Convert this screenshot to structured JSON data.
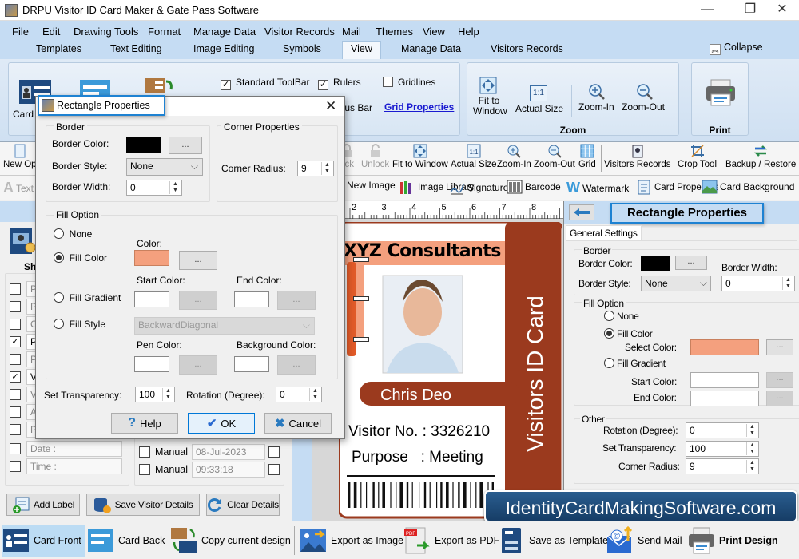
{
  "window": {
    "title": "DRPU Visitor ID Card Maker & Gate Pass Software",
    "controls": {
      "minimize": "—",
      "maximize": "❐",
      "close": "✕"
    }
  },
  "menu": [
    "File",
    "Edit",
    "Drawing Tools",
    "Format",
    "Manage Data",
    "Visitor Records",
    "Mail",
    "Themes",
    "View",
    "Help"
  ],
  "ribbon_tabs": [
    "Templates",
    "Text Editing",
    "Image Editing",
    "Symbols",
    "View",
    "Manage Data",
    "Visitors Records"
  ],
  "active_ribbon_tab": "View",
  "collapse_label": "Collapse",
  "ribbon": {
    "card_front_label": "Card",
    "view_options": [
      {
        "label": "Standard ToolBar",
        "checked": true
      },
      {
        "label": "Rulers",
        "checked": true
      },
      {
        "label": "Gridlines",
        "checked": false
      }
    ],
    "status_bar_label": "tus Bar",
    "grid_properties_link": "Grid Properties",
    "zoom_group": {
      "label": "Zoom",
      "buttons": [
        "Fit to Window",
        "Actual Size",
        "Zoom-In",
        "Zoom-Out"
      ]
    },
    "print_group": {
      "label": "Print"
    }
  },
  "toolbar": {
    "left_partial": "New Op",
    "items": [
      "ock",
      "Unlock",
      "Fit to Window",
      "Actual Size",
      "Zoom-In",
      "Zoom-Out",
      "Grid",
      "Visitors Records",
      "Crop Tool",
      "Backup / Restore"
    ]
  },
  "toolbar2": {
    "left_partial": "Text",
    "items": [
      "New Image",
      "Image Library",
      "Signature",
      "Barcode",
      "Watermark",
      "Card Properties",
      "Card Background"
    ]
  },
  "left_panel": {
    "show_label": "Sh",
    "rows": [
      {
        "label": "P",
        "checked": false
      },
      {
        "label": "P",
        "checked": false
      },
      {
        "label": "C",
        "checked": false
      },
      {
        "label": "Pr",
        "checked": true
      },
      {
        "label": "Pl",
        "checked": false
      },
      {
        "label": "V",
        "checked": true
      },
      {
        "label": "V",
        "checked": false
      },
      {
        "label": "A",
        "checked": false
      },
      {
        "label": "P",
        "checked": false
      },
      {
        "label": "Date :",
        "checked": false
      },
      {
        "label": "Time :",
        "checked": false
      }
    ],
    "manual_rows": [
      {
        "label": "Manual",
        "value": "08-Jul-2023"
      },
      {
        "label": "Manual",
        "value": "09:33:18"
      }
    ],
    "buttons": {
      "add_label": "Add Label",
      "save_visitor": "Save Visitor Details",
      "clear": "Clear Details"
    }
  },
  "dialog": {
    "title": "Rectangle Properties",
    "border": {
      "legend": "Border",
      "color_label": "Border Color:",
      "color": "#000000",
      "style_label": "Border Style:",
      "style_value": "None",
      "width_label": "Border Width:",
      "width_value": "0"
    },
    "corner": {
      "legend": "Corner Properties",
      "radius_label": "Corner Radius:",
      "radius_value": "9"
    },
    "fill": {
      "legend": "Fill Option",
      "options": [
        "None",
        "Fill Color",
        "Fill Gradient",
        "Fill Style"
      ],
      "selected": "Fill Color",
      "color_label": "Color:",
      "color": "#f4a07e",
      "start_color_label": "Start Color:",
      "end_color_label": "End Color:",
      "style_value": "BackwardDiagonal",
      "pen_color_label": "Pen Color:",
      "bg_color_label": "Background Color:"
    },
    "transparency_label": "Set Transparency:",
    "transparency_value": "100",
    "rotation_label": "Rotation (Degree):",
    "rotation_value": "0",
    "dots": "...",
    "buttons": {
      "help": "Help",
      "ok": "OK",
      "cancel": "Cancel"
    }
  },
  "ruler_ticks": [
    "2",
    "3",
    "4",
    "5",
    "6",
    "7",
    "8"
  ],
  "card": {
    "company": "XYZ Consultants",
    "name": "Chris Deo",
    "visitor_no_label": "Visitor No. :",
    "visitor_no": "3326210",
    "purpose_label": "Purpose",
    "purpose": ": Meeting",
    "side_text": "Visitors ID Card",
    "accent": "#9b3a1e",
    "highlight": "#f4a07e"
  },
  "right_panel": {
    "title": "Rectangle Properties",
    "tab": "General Settings",
    "border_legend": "Border",
    "border_color_label": "Border Color:",
    "border_width_label": "Border Width:",
    "border_width_value": "0",
    "border_style_label": "Border Style:",
    "border_style_value": "None",
    "fill_legend": "Fill Option",
    "fill_options": [
      "None",
      "Fill Color",
      "Fill Gradient"
    ],
    "select_color_label": "Select Color:",
    "start_color_label": "Start Color:",
    "end_color_label": "End Color:",
    "other_legend": "Other",
    "rotation_label": "Rotation (Degree):",
    "rotation_value": "0",
    "transparency_label": "Set Transparency:",
    "transparency_value": "100",
    "corner_radius_label": "Corner Radius:",
    "corner_radius_value": "9"
  },
  "banner": "IdentityCardMakingSoftware.com",
  "bottom_bar": [
    "Card Front",
    "Card Back",
    "Copy current design",
    "Export as Image",
    "Export as PDF",
    "Save as Template",
    "Send Mail",
    "Print Design"
  ]
}
